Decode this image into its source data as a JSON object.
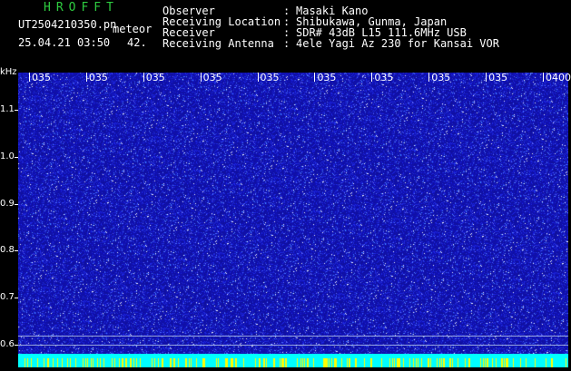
{
  "header": {
    "logo": "HROFFT",
    "filename": "UT2504210350.pn",
    "mode": "meteor",
    "datetime": "25.04.21 03:50",
    "count": "42."
  },
  "info": [
    {
      "label": "Observer",
      "value": "Masaki Kano"
    },
    {
      "label": "Receiving Location",
      "value": "Shibukawa, Gunma, Japan"
    },
    {
      "label": "Receiver",
      "value": "SDR# 43dB L15 111.6MHz USB"
    },
    {
      "label": "Receiving Antenna",
      "value": "4ele Yagi Az 230 for Kansai VOR"
    }
  ],
  "chart_data": {
    "type": "heatmap",
    "ylabel": "kHz",
    "y_ticks": [
      "1.1",
      "1.0",
      "0.9",
      "0.8",
      "0.7",
      "0.6"
    ],
    "ylim": [
      0.58,
      1.18
    ],
    "x_ticks": [
      "035",
      "035",
      "035",
      "035",
      "035",
      "035",
      "035",
      "035",
      "035",
      "0400"
    ],
    "colors": {
      "background": "#1010a0",
      "noise_bright": "#4060ff",
      "noise_white": "#ffffff",
      "bottom_band": "#00ffff",
      "marker": "#ffff00"
    }
  }
}
